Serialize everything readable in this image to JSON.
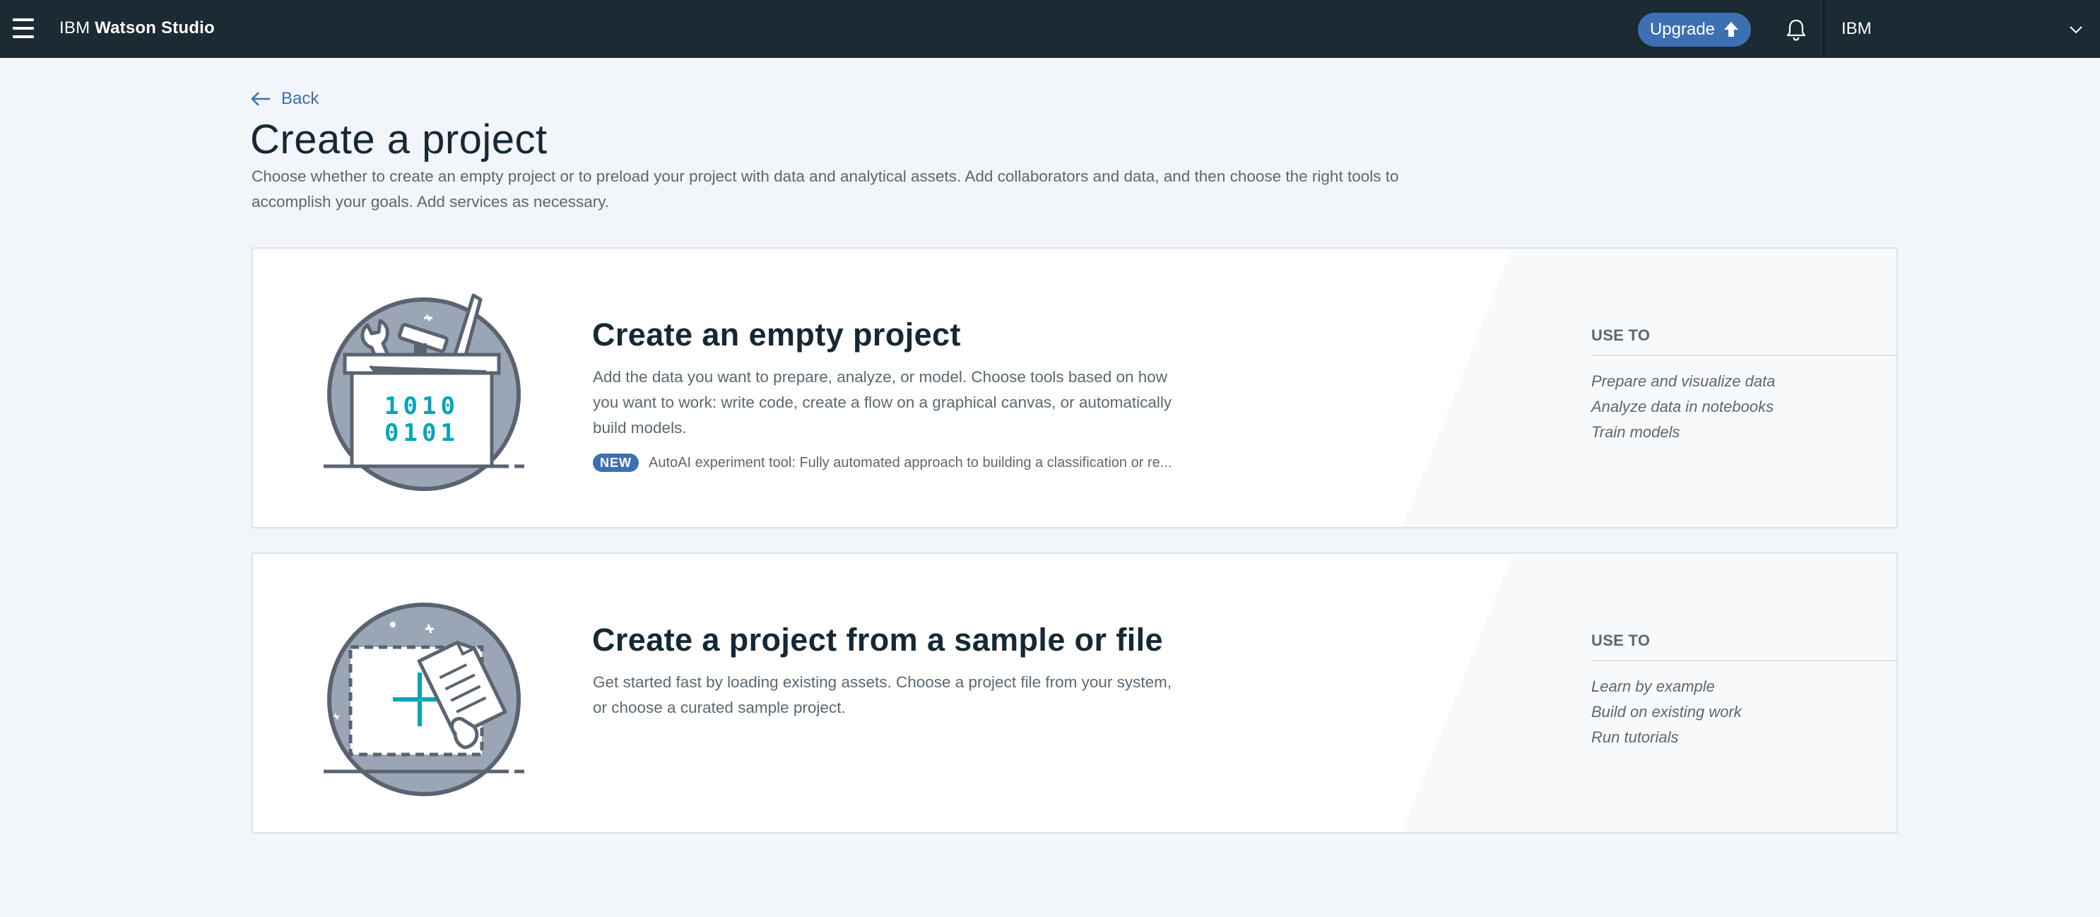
{
  "header": {
    "brand_prefix": "IBM",
    "brand_name": "Watson Studio",
    "upgrade_label": "Upgrade",
    "account_label": "IBM"
  },
  "page": {
    "back_label": "Back",
    "title": "Create a project",
    "description_lines": [
      "Choose whether to create an empty project or to preload your project with data and analytical assets. Add collaborators and data, and then choose the right tools to",
      "accomplish your goals. Add services as necessary."
    ]
  },
  "cards": [
    {
      "title": "Create an empty project",
      "description_lines": [
        "Add the data you want to prepare, analyze, or model. Choose tools based on how",
        "you want to work: write code, create a flow on a graphical canvas, or automatically",
        "build models."
      ],
      "badge": "NEW",
      "badge_text": "AutoAI experiment tool: Fully automated approach to building a classification or re...",
      "useto_heading": "USE TO",
      "useto_items": [
        "Prepare and visualize data",
        "Analyze data in notebooks",
        "Train models"
      ],
      "illustration_text": [
        "1010",
        "0101"
      ]
    },
    {
      "title": "Create a project from a sample or file",
      "description_lines": [
        "Get started fast by loading existing assets. Choose a project file from your system,",
        "or choose a curated sample project."
      ],
      "useto_heading": "USE TO",
      "useto_items": [
        "Learn by example",
        "Build on existing work",
        "Run tutorials"
      ]
    }
  ],
  "colors": {
    "header_bg": "#1b2a33",
    "accent": "#3d70b2",
    "page_bg": "#f2f5f9",
    "illustration_teal": "#00a6b8"
  }
}
